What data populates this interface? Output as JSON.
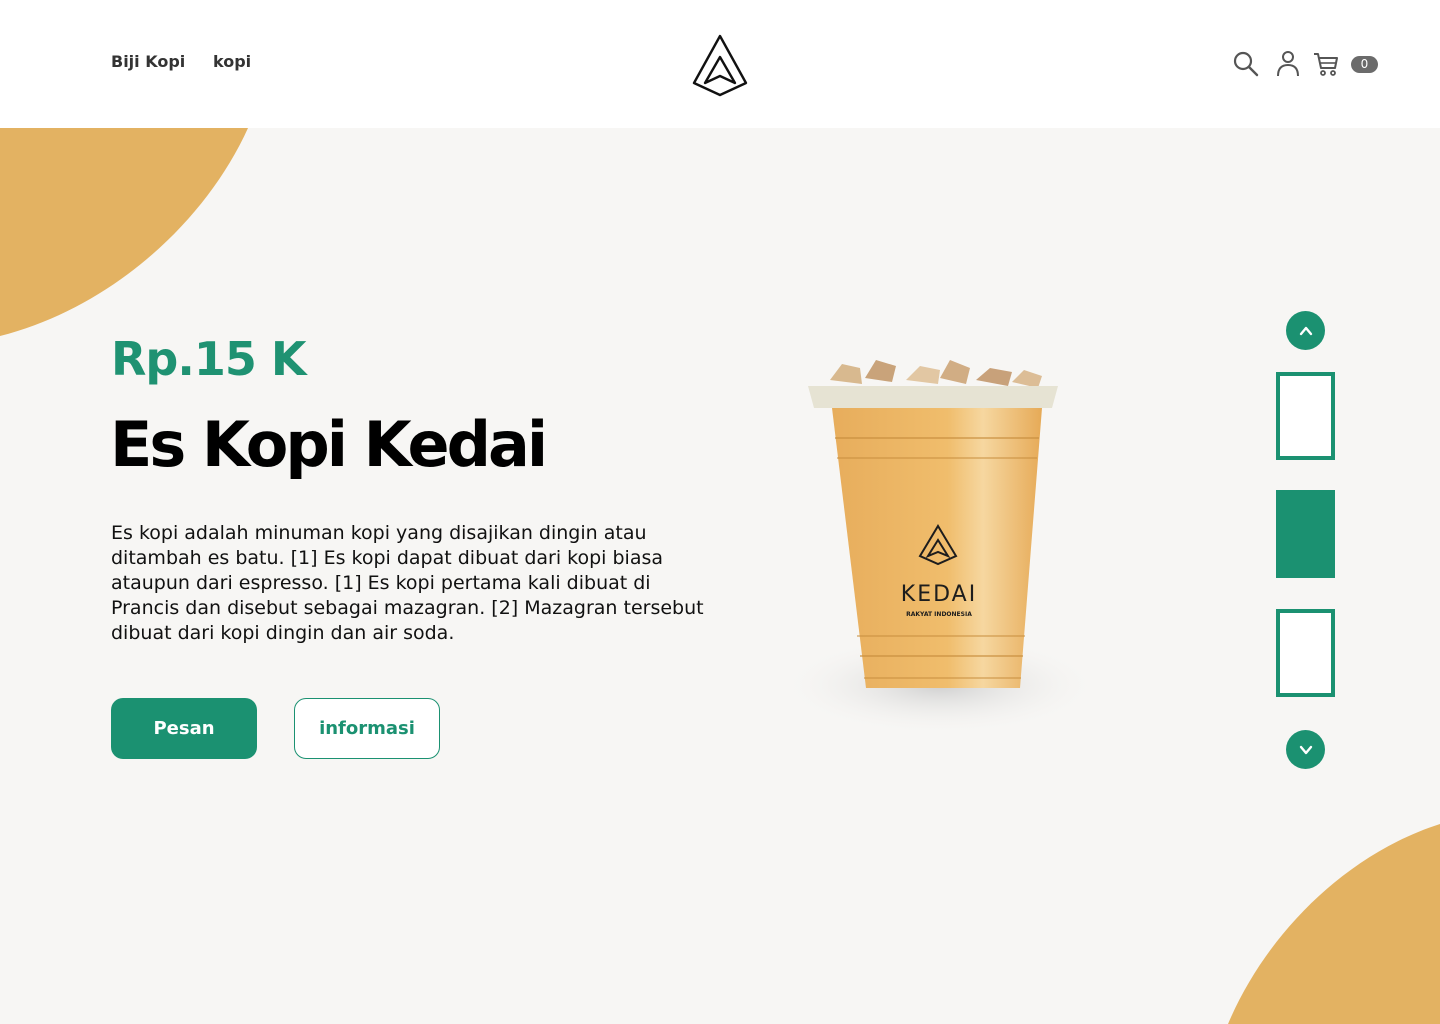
{
  "nav": {
    "items": [
      {
        "label": "Biji Kopi"
      },
      {
        "label": "kopi"
      }
    ]
  },
  "header": {
    "cart_count": "0",
    "icons": [
      "search-icon",
      "user-icon",
      "cart-icon"
    ]
  },
  "product": {
    "price": "Rp.15 K",
    "name": "Es Kopi Kedai",
    "description": "Es kopi adalah minuman kopi yang disajikan dingin atau ditambah es batu. [1] Es kopi dapat dibuat dari kopi biasa ataupun dari espresso. [1] Es kopi pertama kali dibuat di Prancis dan disebut sebagai mazagran. [2] Mazagran tersebut dibuat dari kopi dingin dan air soda.",
    "cup_brand": "KEDAI",
    "cup_subtitle": "RAKYAT INDONESIA"
  },
  "actions": {
    "order_label": "Pesan",
    "info_label": "informasi"
  },
  "carousel": {
    "active_index": 1,
    "count": 3
  },
  "colors": {
    "accent": "#1b9171",
    "decor": "#e3b262",
    "background": "#f7f6f4"
  }
}
